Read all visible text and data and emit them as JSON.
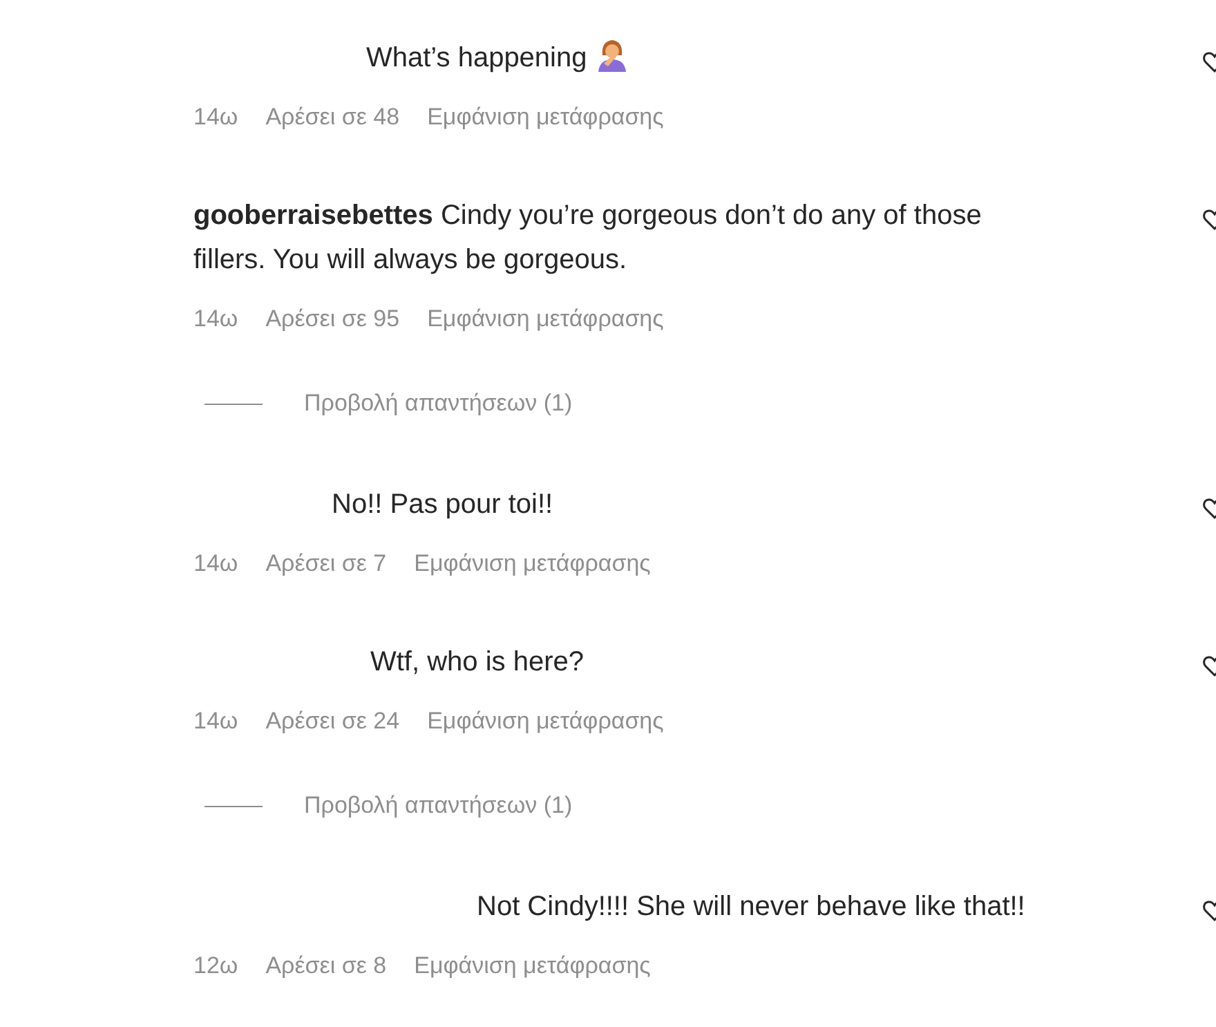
{
  "items": [
    {
      "kind": "comment",
      "text": "What’s happening",
      "has_emoji": true,
      "time": "14ω",
      "likes": "Αρέσει σε 48",
      "translate": "Εμφάνιση μετάφρασης"
    },
    {
      "kind": "comment",
      "username": "gooberraisebettes",
      "text": "Cindy you’re gorgeous don’t do any of those fillers. You will always be gorgeous.",
      "time": "14ω",
      "likes": "Αρέσει σε 95",
      "translate": "Εμφάνιση μετάφρασης"
    },
    {
      "kind": "replies",
      "label": "Προβολή απαντήσεων (1)"
    },
    {
      "kind": "comment",
      "text": "No!! Pas pour toi!!",
      "time": "14ω",
      "likes": "Αρέσει σε 7",
      "translate": "Εμφάνιση μετάφρασης"
    },
    {
      "kind": "comment",
      "text": "Wtf, who is here?",
      "time": "14ω",
      "likes": "Αρέσει σε 24",
      "translate": "Εμφάνιση μετάφρασης"
    },
    {
      "kind": "replies",
      "label": "Προβολή απαντήσεων (1)"
    },
    {
      "kind": "comment",
      "text": "Not Cindy!!!! She will never behave like that!!",
      "time": "12ω",
      "likes": "Αρέσει σε 8",
      "translate": "Εμφάνιση μετάφρασης"
    }
  ]
}
